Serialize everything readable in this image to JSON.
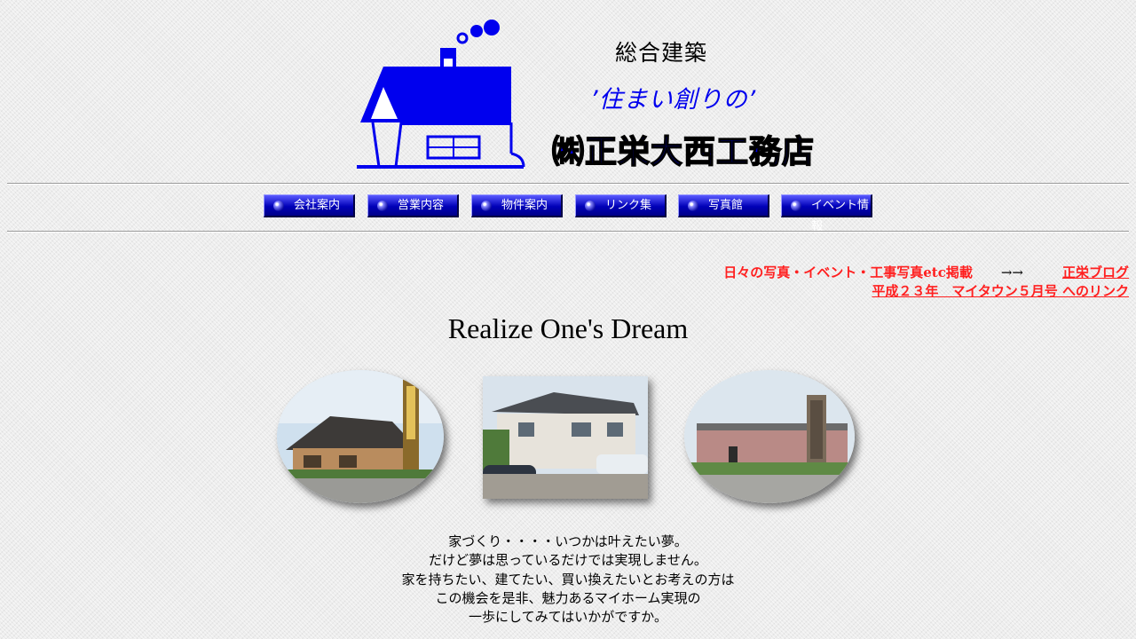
{
  "header": {
    "tagline_1": "総合建築",
    "tagline_2": "’住まい創りの’",
    "company_name": "㈱正栄大西工務店",
    "brand_color": "#0000ee"
  },
  "nav": {
    "items": [
      {
        "label": "会社案内",
        "icon": "blue-bullet-icon"
      },
      {
        "label": "営業内容",
        "icon": "blue-bullet-icon"
      },
      {
        "label": "物件案内",
        "icon": "blue-bullet-icon"
      },
      {
        "label": "リンク集",
        "icon": "blue-bullet-icon"
      },
      {
        "label": "写真館",
        "icon": "blue-bullet-icon"
      },
      {
        "label": "イベント情報",
        "icon": "blue-bullet-icon"
      }
    ]
  },
  "announcements": {
    "blog_text": "日々の写真・イベント・工事写真etc掲載",
    "blog_arrow": "→→",
    "blog_link": "正栄ブログ",
    "mytown_link": "平成２３年　マイタウン５月号 へのリンク",
    "link_color": "#ff2020"
  },
  "main": {
    "headline": "Realize One's Dream",
    "photos": [
      {
        "shape": "oval"
      },
      {
        "shape": "rectangle"
      },
      {
        "shape": "oval"
      }
    ],
    "intro_lines": [
      "家づくり・・・・いつかは叶えたい夢。",
      "だけど夢は思っているだけでは実現しません。",
      "家を持ちたい、建てたい、買い換えたいとお考えの方は",
      "この機会を是非、魅力あるマイホーム実現の",
      "一歩にしてみてはいかがですか。"
    ]
  }
}
